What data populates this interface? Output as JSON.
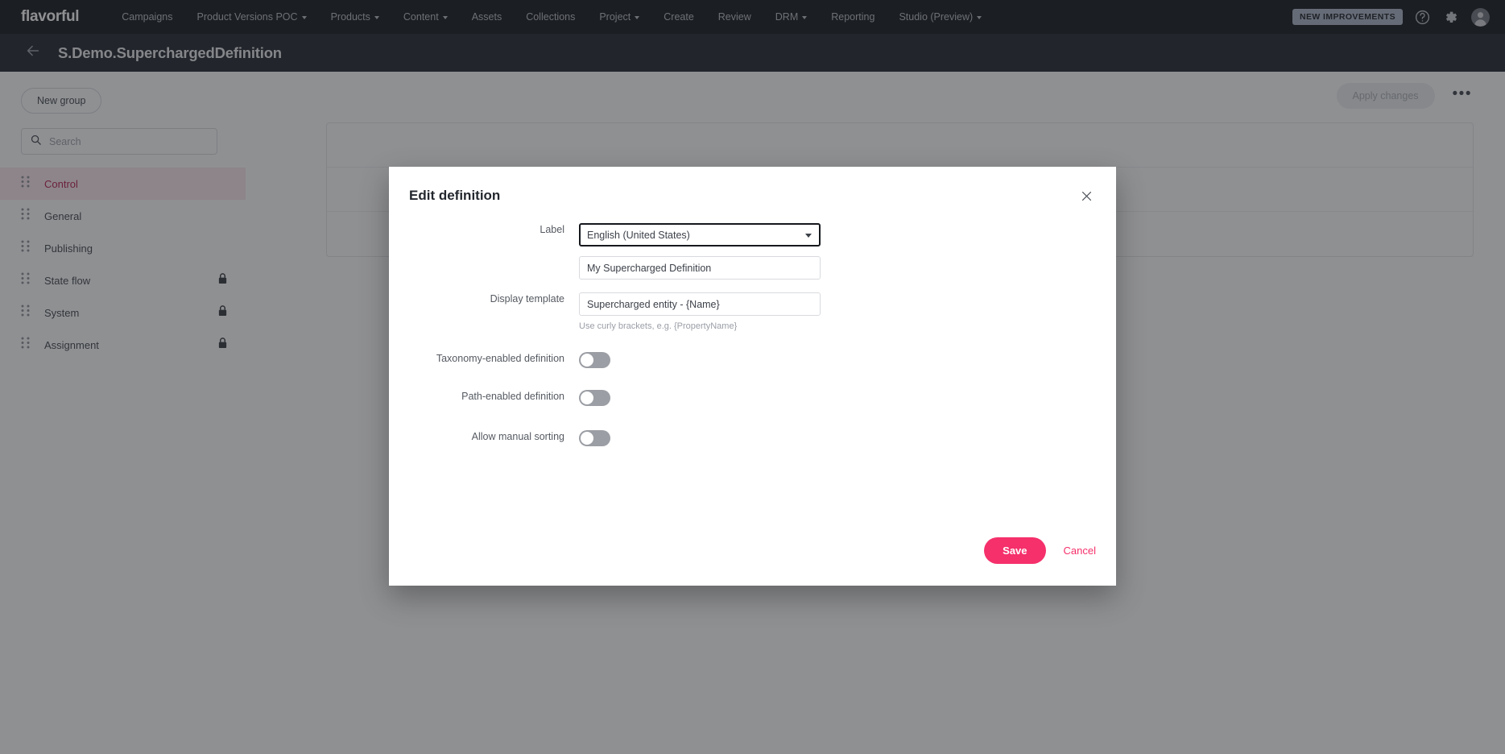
{
  "topnav": {
    "brand": "flavorful",
    "items": [
      {
        "label": "Campaigns",
        "caret": false
      },
      {
        "label": "Product Versions POC",
        "caret": true
      },
      {
        "label": "Products",
        "caret": true
      },
      {
        "label": "Content",
        "caret": true
      },
      {
        "label": "Assets",
        "caret": false
      },
      {
        "label": "Collections",
        "caret": false
      },
      {
        "label": "Project",
        "caret": true
      },
      {
        "label": "Create",
        "caret": false
      },
      {
        "label": "Review",
        "caret": false
      },
      {
        "label": "DRM",
        "caret": true
      },
      {
        "label": "Reporting",
        "caret": false
      },
      {
        "label": "Studio (Preview)",
        "caret": true
      }
    ],
    "badge": "NEW IMPROVEMENTS",
    "help_icon": "help-circle-icon",
    "settings_icon": "gear-icon",
    "avatar_icon": "user-avatar-icon"
  },
  "pageheader": {
    "back_icon": "back-arrow-icon",
    "title": "S.Demo.SuperchargedDefinition"
  },
  "sidebar": {
    "new_group_label": "New group",
    "search": {
      "placeholder": "Search",
      "value": "",
      "icon": "search-icon"
    },
    "groups": [
      {
        "label": "Control",
        "active": true,
        "locked": false
      },
      {
        "label": "General",
        "active": false,
        "locked": false
      },
      {
        "label": "Publishing",
        "active": false,
        "locked": false
      },
      {
        "label": "State flow",
        "active": false,
        "locked": true
      },
      {
        "label": "System",
        "active": false,
        "locked": true
      },
      {
        "label": "Assignment",
        "active": false,
        "locked": true
      }
    ]
  },
  "toolbar": {
    "apply_label": "Apply changes",
    "apply_disabled": true,
    "more_label": "•••"
  },
  "modal": {
    "title": "Edit definition",
    "close_icon": "close-icon",
    "fields": {
      "label_label": "Label",
      "language_value": "English (United States)",
      "language_options": [
        "English (United States)"
      ],
      "name_value": "My Supercharged Definition",
      "display_template_label": "Display template",
      "display_template_value": "Supercharged entity - {Name}",
      "display_template_hint": "Use curly brackets, e.g. {PropertyName}"
    },
    "toggles": [
      {
        "label": "Taxonomy-enabled definition",
        "on": false
      },
      {
        "label": "Path-enabled definition",
        "on": false
      },
      {
        "label": "Allow manual sorting",
        "on": false
      }
    ],
    "save_label": "Save",
    "cancel_label": "Cancel"
  },
  "colors": {
    "accent_pink": "#f5306b",
    "nav_bg": "#0e1117",
    "header_bg": "#1c2029",
    "active_row_bg": "#fbe9ef",
    "active_row_text": "#b4184d"
  }
}
